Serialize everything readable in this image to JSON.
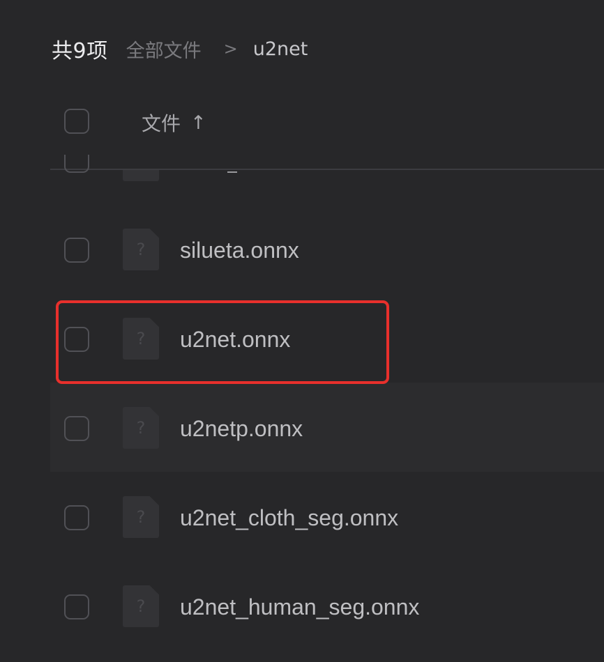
{
  "header": {
    "count_label": "共9项",
    "breadcrumb": {
      "root": "全部文件",
      "separator": ">",
      "current": "u2net"
    }
  },
  "columns": {
    "name_header": "文件",
    "sort_indicator": "↑"
  },
  "files": [
    {
      "name": "silueta.onnx",
      "icon": "unknown-file-icon",
      "icon_glyph": "?"
    },
    {
      "name": "u2net.onnx",
      "icon": "unknown-file-icon",
      "icon_glyph": "?"
    },
    {
      "name": "u2netp.onnx",
      "icon": "unknown-file-icon",
      "icon_glyph": "?"
    },
    {
      "name": "u2net_cloth_seg.onnx",
      "icon": "unknown-file-icon",
      "icon_glyph": "?"
    },
    {
      "name": "u2net_human_seg.onnx",
      "icon": "unknown-file-icon",
      "icon_glyph": "?"
    }
  ],
  "colors": {
    "background": "#272729",
    "hover_row": "#2c2c2e",
    "highlight_border": "#e8302c",
    "text_primary": "#ececee",
    "text_muted": "#7a7a7e"
  }
}
